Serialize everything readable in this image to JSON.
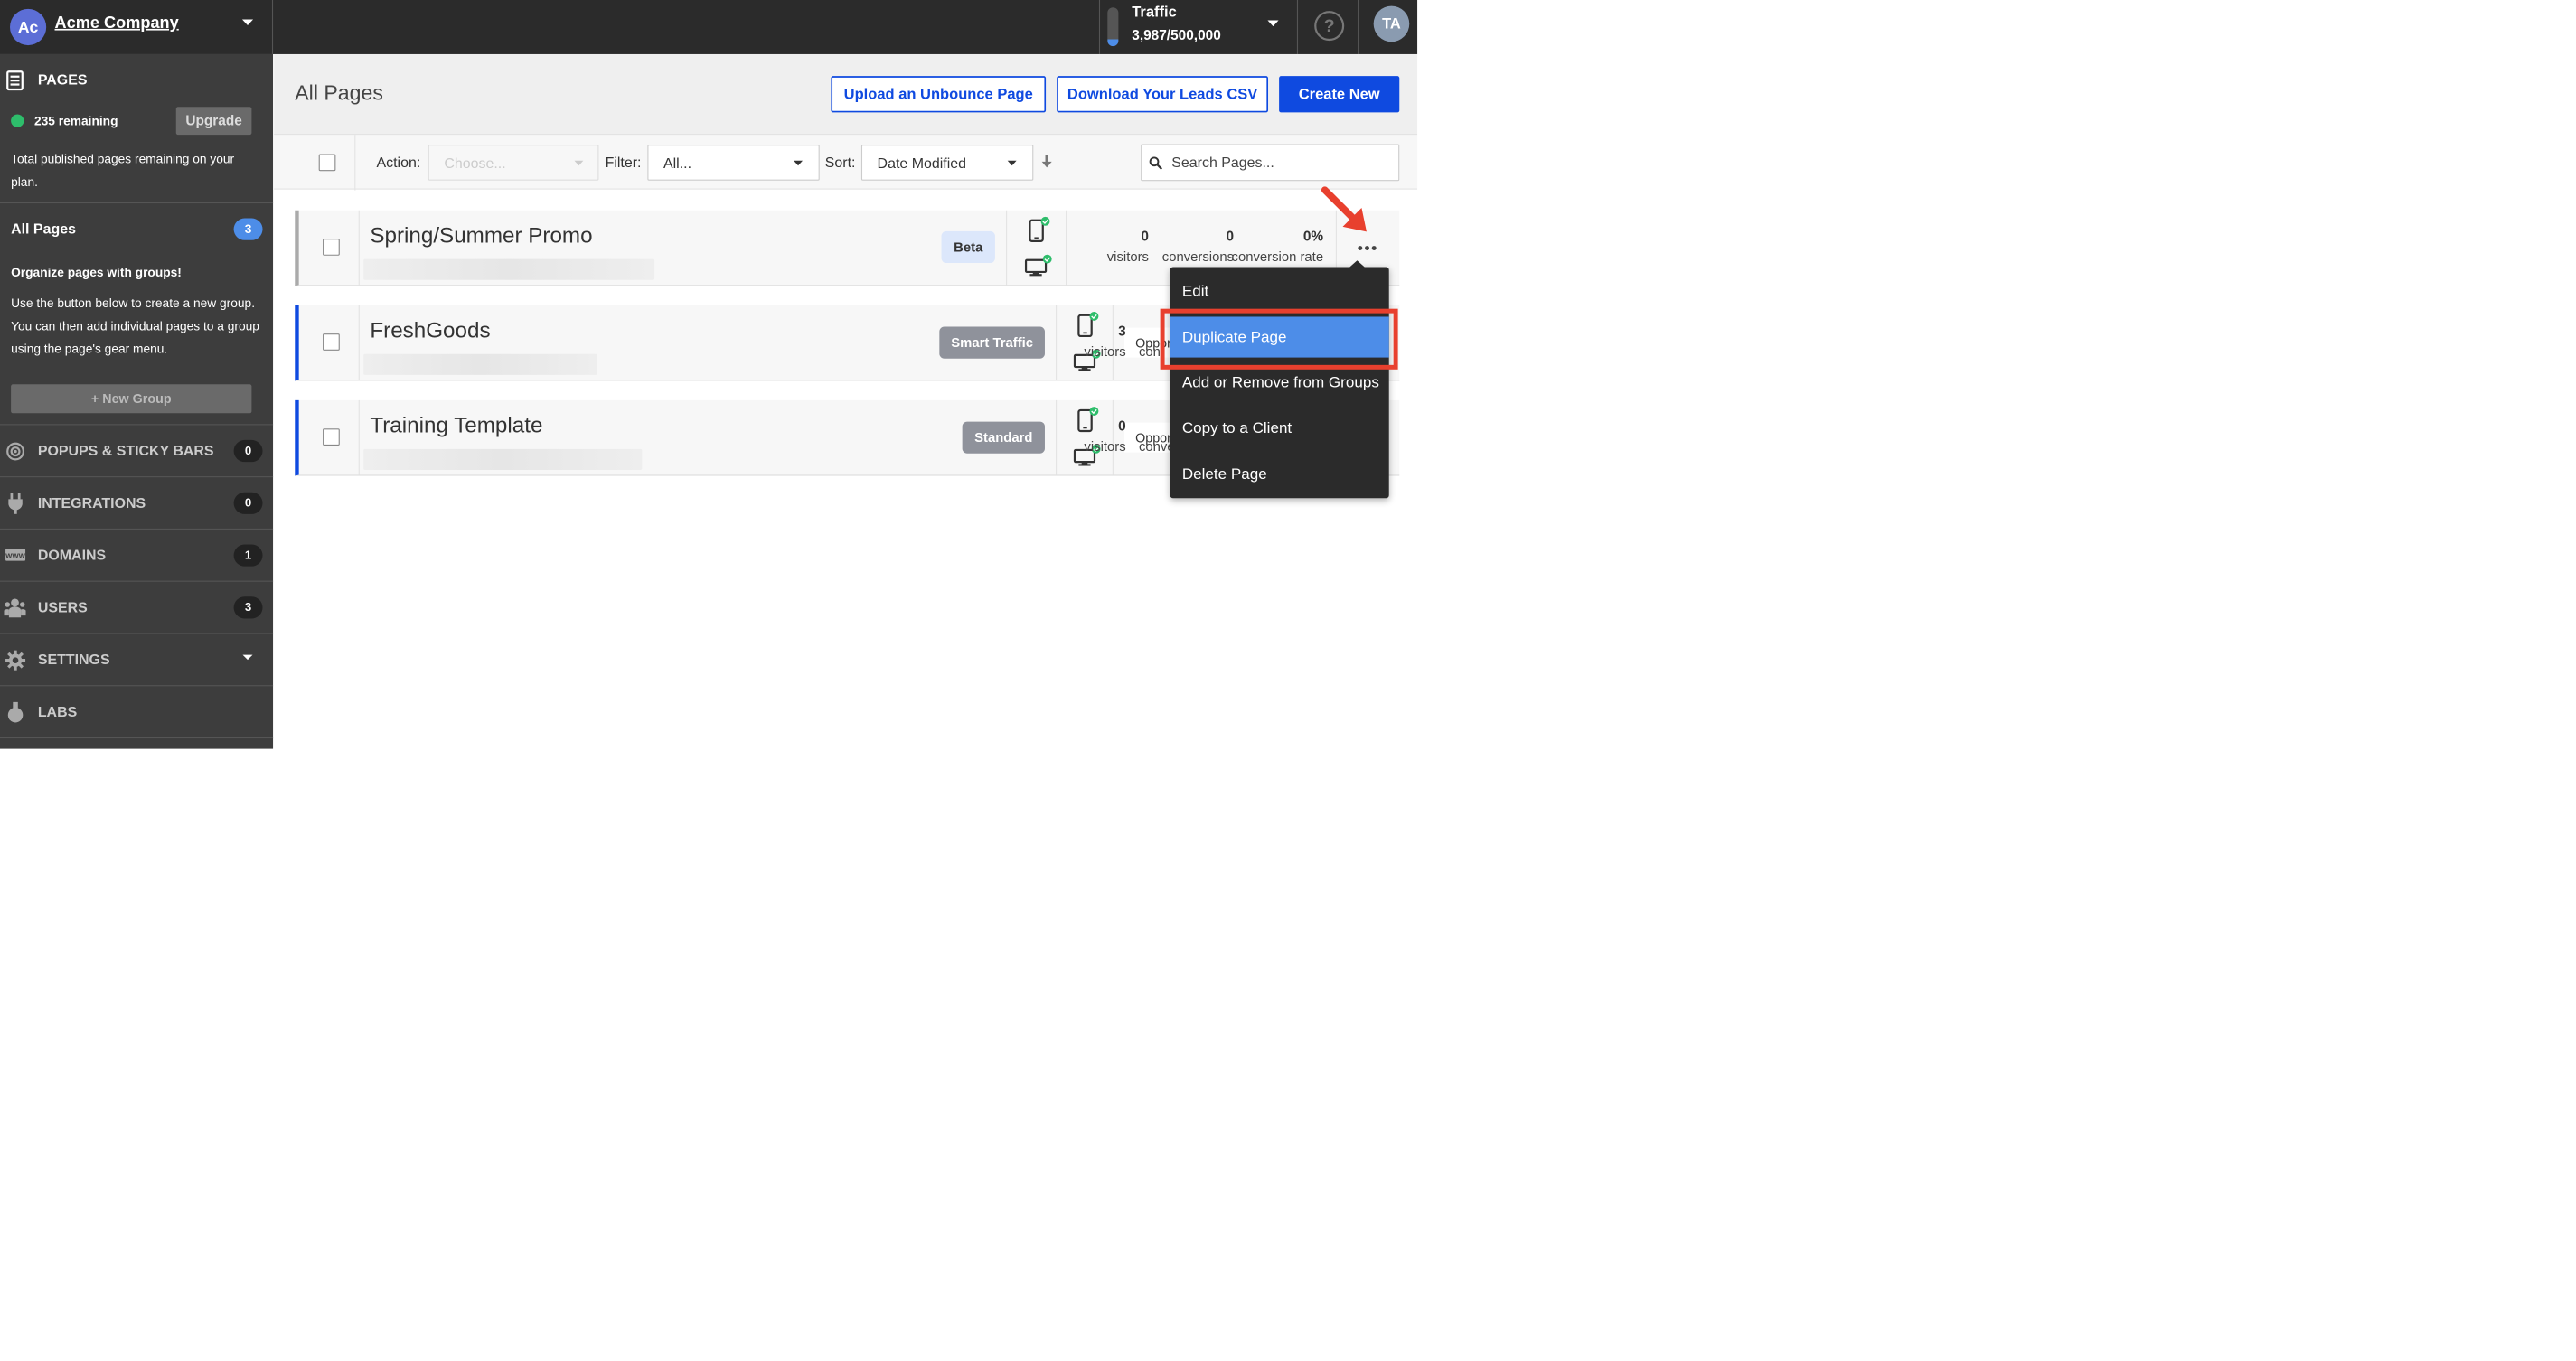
{
  "account": {
    "initials": "Ac",
    "name": "Acme Company"
  },
  "traffic": {
    "label": "Traffic",
    "value": "3,987/500,000",
    "fill_fraction": 0.008
  },
  "help": {
    "glyph": "?"
  },
  "user": {
    "initials": "TA"
  },
  "sidebar": {
    "pages_title": "PAGES",
    "remaining": "235 remaining",
    "upgrade": "Upgrade",
    "remaining_desc": "Total published pages remaining on your plan.",
    "all_pages_label": "All Pages",
    "all_pages_count": "3",
    "organize_title": "Organize pages with groups!",
    "organize_desc": "Use the button below to create a new group. You can then add individual pages to a group using the page's gear menu.",
    "new_group": "+ New Group",
    "nav": [
      {
        "label": "POPUPS & STICKY BARS",
        "count": "0",
        "icon": "target-icon"
      },
      {
        "label": "INTEGRATIONS",
        "count": "0",
        "icon": "plug-icon"
      },
      {
        "label": "DOMAINS",
        "count": "1",
        "icon": "www-icon"
      },
      {
        "label": "USERS",
        "count": "3",
        "icon": "users-icon"
      },
      {
        "label": "SETTINGS",
        "count": "",
        "icon": "gear-icon"
      },
      {
        "label": "LABS",
        "count": "",
        "icon": "flask-icon"
      }
    ]
  },
  "main": {
    "title": "All Pages",
    "upload_btn": "Upload an Unbounce Page",
    "download_btn": "Download Your Leads CSV",
    "create_btn": "Create New",
    "action_label": "Action:",
    "action_placeholder": "Choose...",
    "filter_label": "Filter:",
    "filter_value": "All...",
    "sort_label": "Sort:",
    "sort_value": "Date Modified",
    "search_placeholder": "Search Pages..."
  },
  "rows": [
    {
      "name": "Spring/Summer Promo",
      "badge": "Beta",
      "stat1_value": "0",
      "stat1_label": "visitors",
      "stat2_value": "0",
      "stat2_label": "conversions",
      "stat3_value": "0%",
      "stat3_label": "conversion rate"
    },
    {
      "name": "FreshGoods",
      "badge": "Smart Traffic",
      "opportunity": "Opportunity to improve",
      "stat1_value": "3",
      "stat1_label": "visitors",
      "stat2_partial": "con"
    },
    {
      "name": "Training Template",
      "badge": "Standard",
      "opportunity": "Opportunity to improve",
      "stat1_value": "0",
      "stat1_label": "visitors",
      "stat2_partial": "conve"
    }
  ],
  "menu": {
    "items": [
      "Edit",
      "Duplicate Page",
      "Add or Remove from Groups",
      "Copy to a Client",
      "Delete Page"
    ]
  },
  "colors": {
    "accent": "#0f4ae0",
    "sidebar_bg": "#3d3d3d",
    "topbar_bg": "#2b2b2b",
    "highlight": "#4d8de8",
    "annotation": "#e8402e",
    "status_green": "#2ebd6b"
  }
}
